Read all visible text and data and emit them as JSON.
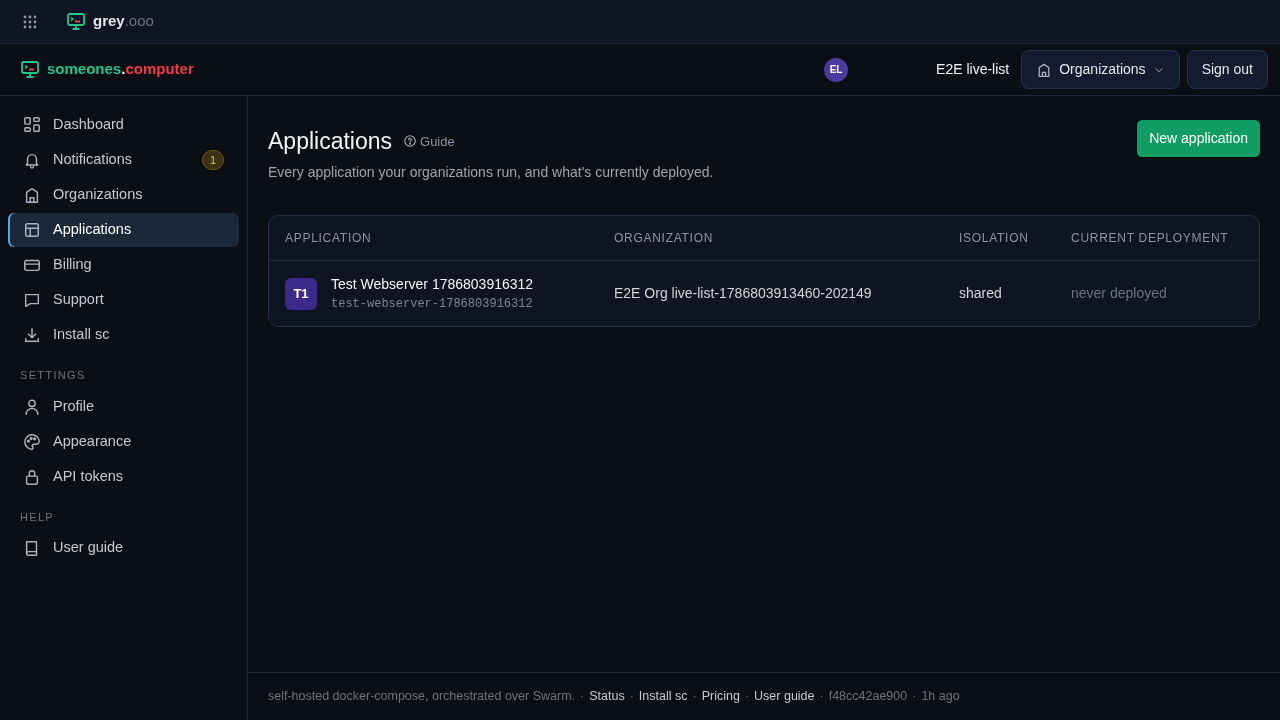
{
  "topbar": {
    "brand": "grey",
    "brand_suffix": ".ooo"
  },
  "header": {
    "brand": "someones",
    "brand_dot": ".",
    "brand_suffix": "computer",
    "avatar": "EL",
    "context": "E2E live-list",
    "org_button": "Organizations",
    "sign_out": "Sign out"
  },
  "sidebar": {
    "sections": [
      {
        "items": [
          {
            "label": "Dashboard",
            "selected": false
          },
          {
            "label": "Notifications",
            "selected": false,
            "badge": "1"
          },
          {
            "label": "Organizations",
            "selected": false
          },
          {
            "label": "Applications",
            "selected": true
          },
          {
            "label": "Billing",
            "selected": false
          },
          {
            "label": "Support",
            "selected": false
          },
          {
            "label": "Install sc",
            "selected": false
          }
        ]
      },
      {
        "heading": "SETTINGS",
        "items": [
          {
            "label": "Profile",
            "selected": false
          },
          {
            "label": "Appearance",
            "selected": false
          },
          {
            "label": "API tokens",
            "selected": false
          }
        ]
      },
      {
        "heading": "HELP",
        "items": [
          {
            "label": "User guide",
            "selected": false
          }
        ]
      }
    ]
  },
  "page": {
    "title": "Applications",
    "guide": "Guide",
    "subtitle": "Every application your organizations run, and what's currently deployed.",
    "new_button": "New application"
  },
  "table": {
    "columns": [
      "APPLICATION",
      "ORGANIZATION",
      "ISOLATION",
      "CURRENT DEPLOYMENT"
    ],
    "rows": [
      {
        "initials": "T1",
        "name": "Test Webserver 1786803916312",
        "slug": "test-webserver-1786803916312",
        "organization": "E2E Org live-list-1786803913460-202149",
        "isolation": "shared",
        "deployment": "never deployed"
      }
    ]
  },
  "footer": [
    {
      "kind": "text",
      "text": "self-hosted docker-compose, orchestrated over Swarm."
    },
    {
      "kind": "sep",
      "text": "·"
    },
    {
      "kind": "link",
      "text": "Status"
    },
    {
      "kind": "sep",
      "text": "·"
    },
    {
      "kind": "link",
      "text": "Install sc"
    },
    {
      "kind": "sep",
      "text": "·"
    },
    {
      "kind": "link",
      "text": "Pricing"
    },
    {
      "kind": "sep",
      "text": "·"
    },
    {
      "kind": "link",
      "text": "User guide"
    },
    {
      "kind": "sep",
      "text": "·"
    },
    {
      "kind": "text",
      "text": "f48cc42ae900"
    },
    {
      "kind": "sep",
      "text": "·"
    },
    {
      "kind": "text",
      "text": "1h ago"
    }
  ]
}
